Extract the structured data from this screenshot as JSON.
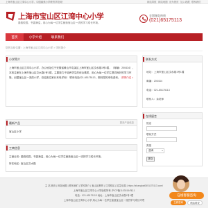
{
  "top_strip": {
    "left_text": "上海市宝山区江湾中心小学，中国最美小学教育学校网！",
    "links": [
      "网站导航",
      "网站地图",
      "设为首页",
      "加入收藏",
      "联系我们"
    ]
  },
  "header": {
    "title": "上海市宝山区江湾中心小学",
    "description": "墨韵校园，书香满溢，用心为每一位学生营造宝山区一流的学习成长环境。",
    "phone_label": "全国服务热线",
    "phone_number": "(021)65175113"
  },
  "nav": {
    "items": [
      "首页",
      "小学介绍",
      "联系我们"
    ]
  },
  "breadcrumb": "您的当前位置：上海市宝山区江湾中心小学 > 学校简介",
  "intro_panel": {
    "title": "小学简介",
    "text_1": "上海市宝山区江湾中心小学，办公地址位于安徽省黄山市屯溪区上海市宝山区汶水路1号1幢，（邮编：200434），本校注册在上海市宝山区汶水路1号1幢，主要致力于培养学生的综合素质，用心为每一位学生提供良好的学习环境，创建宝山区一流的小学，欢迎各位家长来电详询！",
    "text_2": "联系电话021-65175113，期待您的来电咨询。",
    "more_link": "详情介绍 >"
  },
  "news_panel": {
    "title": "最新产品",
    "more": "更多产品信息",
    "item": "宝山区小学"
  },
  "business_panel": {
    "title": "工商信息",
    "rows": [
      {
        "label": "主营业务：",
        "value": "墨韵校园，书香满溢，用心为每一位学生营造宝山区一流的学习成长环境。"
      },
      {
        "label": "所在地区：",
        "value": "宝山区汶水路"
      }
    ]
  },
  "contact_panel": {
    "title": "联系方式",
    "lines": [
      "地址：上海市宝山区汶水路1号1幢",
      "邮编：200434",
      "电话：021-65175113",
      "联系人：余老师"
    ]
  },
  "message_panel": {
    "title": "在线留言",
    "name_label": "姓名",
    "contact_label": "联系方式",
    "select_label": "类型",
    "select_value": "咨询",
    "submit": "提交"
  },
  "footer": {
    "lines": [
      "主 站 首页 | 网站地图 | 联系我们 | 学校简介 | 宝山区教育 | 江湾校区 | 招生信息 | https://shanghai0651175113.com/",
      "上海市宝山区江湾中心小学版权所有 沪ICP备11030154号-1",
      "电话：021-65175113  地址：上海市宝山区汶水路1号1幢",
      "上海市宝山区江湾中心小学 用心为每一位学生营造宝山区一流的学习成长环境"
    ]
  },
  "chat_widget": {
    "title": "在线客服咨询",
    "consult": "立即咨询",
    "later": "稍后再说"
  },
  "colors": {
    "brand": "#b72025",
    "accent": "#f2871a"
  }
}
